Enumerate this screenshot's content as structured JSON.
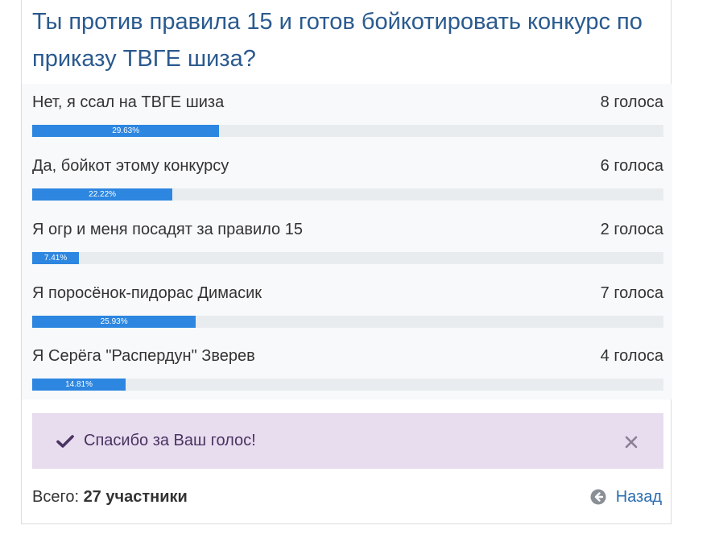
{
  "poll": {
    "question": "Ты против правила 15 и готов бойкотировать конкурс по приказу ТВГЕ шиза?",
    "answers": [
      {
        "label": "Нет, я ссал на ТВГЕ шиза",
        "votes": "8 голоса",
        "percent_label": "29.63%",
        "percent": 29.63
      },
      {
        "label": "Да, бойкот этому конкурсу",
        "votes": "6 голоса",
        "percent_label": "22.22%",
        "percent": 22.22
      },
      {
        "label": "Я огр и меня посадят за правило 15",
        "votes": "2 голоса",
        "percent_label": "7.41%",
        "percent": 7.41
      },
      {
        "label": "Я поросёнок-пидорас Димасик",
        "votes": "7 голоса",
        "percent_label": "25.93%",
        "percent": 25.93
      },
      {
        "label": "Я Серёга \"Распердун\" Зверев",
        "votes": "4 голоса",
        "percent_label": "14.81%",
        "percent": 14.81
      }
    ],
    "alert": {
      "message": "Спасибо за Ваш голос!",
      "icon": "check-icon",
      "close_icon": "close-icon"
    },
    "footer": {
      "total_label": "Всего:",
      "total_value": "27 участники",
      "back_label": "Назад",
      "back_icon": "arrow-left-circle-icon"
    }
  },
  "colors": {
    "question": "#2a5a8f",
    "bar_fill": "#2d86e0",
    "bar_track": "#e9ecef",
    "results_bg": "#f8f9fa",
    "alert_bg": "#e8dcef",
    "alert_text": "#4a3360",
    "link": "#2a6db0"
  }
}
